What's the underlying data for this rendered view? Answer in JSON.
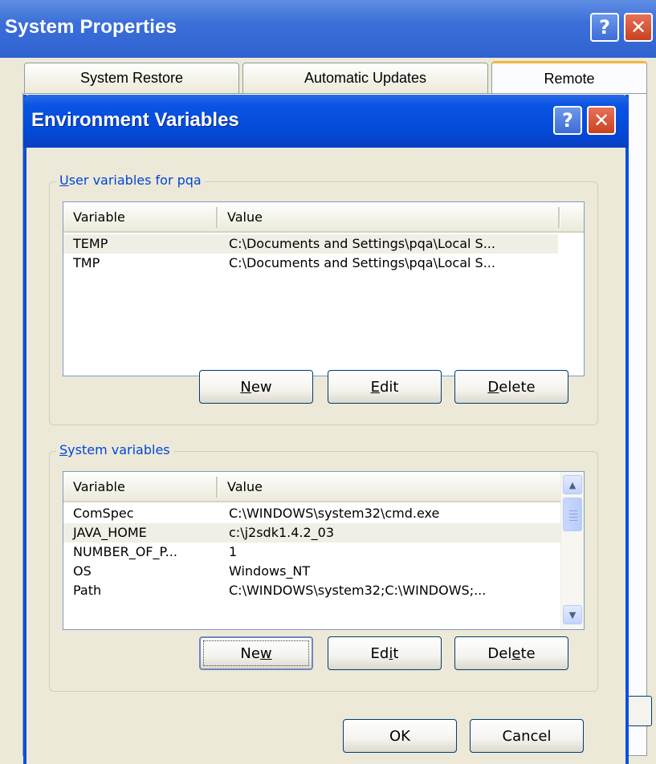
{
  "system_properties": {
    "title": "System Properties",
    "tabs": [
      {
        "label": "System Restore"
      },
      {
        "label": "Automatic Updates"
      },
      {
        "label": "Remote"
      }
    ],
    "active_tab": "Remote"
  },
  "env_dialog": {
    "title": "Environment Variables",
    "user_group": {
      "label_mnemonic": "U",
      "label_rest": "ser variables for pqa",
      "columns": [
        "Variable",
        "Value"
      ],
      "rows": [
        {
          "variable": "TEMP",
          "value": "C:\\Documents and Settings\\pqa\\Local S..."
        },
        {
          "variable": "TMP",
          "value": "C:\\Documents and Settings\\pqa\\Local S..."
        }
      ],
      "buttons": {
        "new": {
          "mnemonic": "N",
          "rest": "ew"
        },
        "edit": {
          "mnemonic": "E",
          "rest": "dit"
        },
        "delete": {
          "mnemonic": "D",
          "rest": "elete"
        }
      }
    },
    "system_group": {
      "label_mnemonic": "S",
      "label_rest": "ystem variables",
      "columns": [
        "Variable",
        "Value"
      ],
      "rows": [
        {
          "variable": "ComSpec",
          "value": "C:\\WINDOWS\\system32\\cmd.exe"
        },
        {
          "variable": "JAVA_HOME",
          "value": "c:\\j2sdk1.4.2_03"
        },
        {
          "variable": "NUMBER_OF_P...",
          "value": "1"
        },
        {
          "variable": "OS",
          "value": "Windows_NT"
        },
        {
          "variable": "Path",
          "value": "C:\\WINDOWS\\system32;C:\\WINDOWS;..."
        }
      ],
      "buttons": {
        "new": {
          "pre": "Ne",
          "mnemonic": "w"
        },
        "edit": {
          "pre": "Ed",
          "mnemonic": "i",
          "post": "t"
        },
        "delete": {
          "pre": "Del",
          "mnemonic": "e",
          "post": "te"
        }
      }
    },
    "ok_label": "OK",
    "cancel_label": "Cancel"
  },
  "icons": {
    "help": "question-mark-icon",
    "close": "close-x-icon",
    "scroll_up": "chevron-up-icon",
    "scroll_down": "chevron-down-icon"
  },
  "colors": {
    "titlebar_blue": "#0449d7",
    "dialog_face": "#ece9d8",
    "group_label": "#0046d5",
    "close_red": "#c8431f",
    "active_tab_accent": "#f3b643"
  }
}
